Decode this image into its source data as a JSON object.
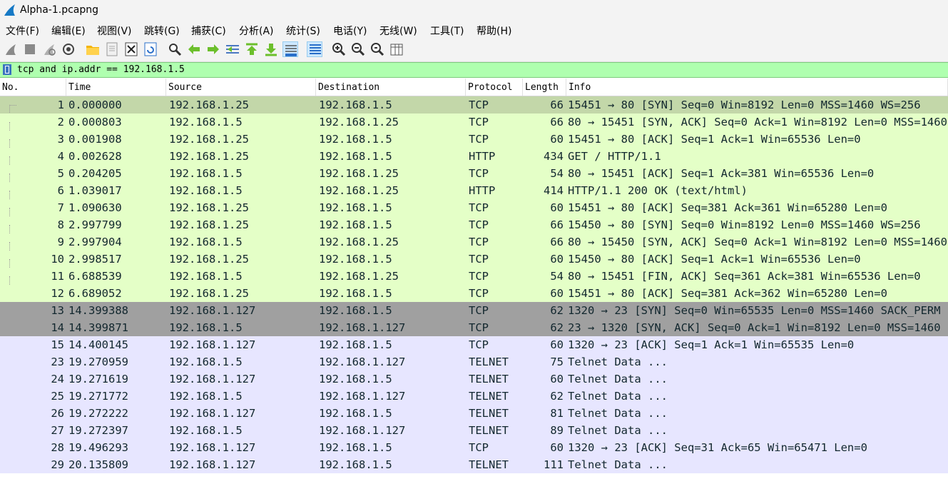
{
  "window": {
    "title": "Alpha-1.pcapng"
  },
  "menu": [
    "文件(F)",
    "编辑(E)",
    "视图(V)",
    "跳转(G)",
    "捕获(C)",
    "分析(A)",
    "统计(S)",
    "电话(Y)",
    "无线(W)",
    "工具(T)",
    "帮助(H)"
  ],
  "toolbar": [
    {
      "name": "start-capture-icon"
    },
    {
      "name": "stop-capture-icon"
    },
    {
      "name": "restart-capture-icon"
    },
    {
      "name": "capture-options-icon"
    },
    {
      "name": "open-file-icon"
    },
    {
      "name": "save-file-icon"
    },
    {
      "name": "close-file-icon"
    },
    {
      "name": "reload-file-icon"
    },
    {
      "name": "find-packet-icon"
    },
    {
      "name": "go-back-icon"
    },
    {
      "name": "go-forward-icon"
    },
    {
      "name": "go-to-packet-icon"
    },
    {
      "name": "go-first-icon"
    },
    {
      "name": "go-last-icon"
    },
    {
      "name": "auto-scroll-icon"
    },
    {
      "name": "colorize-icon"
    },
    {
      "name": "zoom-in-icon"
    },
    {
      "name": "zoom-out-icon"
    },
    {
      "name": "zoom-normal-icon"
    },
    {
      "name": "resize-columns-icon"
    }
  ],
  "filter": {
    "value": "tcp and ip.addr == 192.168.1.5"
  },
  "columns": [
    "No.",
    "Time",
    "Source",
    "Destination",
    "Protocol",
    "Length",
    "Info"
  ],
  "row_colors": {
    "tcp": "#e4ffc7",
    "http": "#e4ffc7",
    "telnet": "#e7e6ff",
    "selected": "#c3d7a9",
    "syn_grey": "#a0a0a0"
  },
  "packets": [
    {
      "no": "1",
      "time": "0.000000",
      "src": "192.168.1.25",
      "dst": "192.168.1.5",
      "proto": "TCP",
      "len": "66",
      "info": "15451 → 80 [SYN] Seq=0 Win=8192 Len=0 MSS=1460 WS=256",
      "style": "selected"
    },
    {
      "no": "2",
      "time": "0.000803",
      "src": "192.168.1.5",
      "dst": "192.168.1.25",
      "proto": "TCP",
      "len": "66",
      "info": "80 → 15451 [SYN, ACK] Seq=0 Ack=1 Win=8192 Len=0 MSS=1460",
      "style": "tcp"
    },
    {
      "no": "3",
      "time": "0.001908",
      "src": "192.168.1.25",
      "dst": "192.168.1.5",
      "proto": "TCP",
      "len": "60",
      "info": "15451 → 80 [ACK] Seq=1 Ack=1 Win=65536 Len=0",
      "style": "tcp"
    },
    {
      "no": "4",
      "time": "0.002628",
      "src": "192.168.1.25",
      "dst": "192.168.1.5",
      "proto": "HTTP",
      "len": "434",
      "info": "GET / HTTP/1.1",
      "style": "http"
    },
    {
      "no": "5",
      "time": "0.204205",
      "src": "192.168.1.5",
      "dst": "192.168.1.25",
      "proto": "TCP",
      "len": "54",
      "info": "80 → 15451 [ACK] Seq=1 Ack=381 Win=65536 Len=0",
      "style": "tcp"
    },
    {
      "no": "6",
      "time": "1.039017",
      "src": "192.168.1.5",
      "dst": "192.168.1.25",
      "proto": "HTTP",
      "len": "414",
      "info": "HTTP/1.1 200 OK  (text/html)",
      "style": "http"
    },
    {
      "no": "7",
      "time": "1.090630",
      "src": "192.168.1.25",
      "dst": "192.168.1.5",
      "proto": "TCP",
      "len": "60",
      "info": "15451 → 80 [ACK] Seq=381 Ack=361 Win=65280 Len=0",
      "style": "tcp"
    },
    {
      "no": "8",
      "time": "2.997799",
      "src": "192.168.1.25",
      "dst": "192.168.1.5",
      "proto": "TCP",
      "len": "66",
      "info": "15450 → 80 [SYN] Seq=0 Win=8192 Len=0 MSS=1460 WS=256",
      "style": "tcp"
    },
    {
      "no": "9",
      "time": "2.997904",
      "src": "192.168.1.5",
      "dst": "192.168.1.25",
      "proto": "TCP",
      "len": "66",
      "info": "80 → 15450 [SYN, ACK] Seq=0 Ack=1 Win=8192 Len=0 MSS=1460",
      "style": "tcp"
    },
    {
      "no": "10",
      "time": "2.998517",
      "src": "192.168.1.25",
      "dst": "192.168.1.5",
      "proto": "TCP",
      "len": "60",
      "info": "15450 → 80 [ACK] Seq=1 Ack=1 Win=65536 Len=0",
      "style": "tcp"
    },
    {
      "no": "11",
      "time": "6.688539",
      "src": "192.168.1.5",
      "dst": "192.168.1.25",
      "proto": "TCP",
      "len": "54",
      "info": "80 → 15451 [FIN, ACK] Seq=361 Ack=381 Win=65536 Len=0",
      "style": "tcp"
    },
    {
      "no": "12",
      "time": "6.689052",
      "src": "192.168.1.25",
      "dst": "192.168.1.5",
      "proto": "TCP",
      "len": "60",
      "info": "15451 → 80 [ACK] Seq=381 Ack=362 Win=65280 Len=0",
      "style": "tcp"
    },
    {
      "no": "13",
      "time": "14.399388",
      "src": "192.168.1.127",
      "dst": "192.168.1.5",
      "proto": "TCP",
      "len": "62",
      "info": "1320 → 23 [SYN] Seq=0 Win=65535 Len=0 MSS=1460 SACK_PERM",
      "style": "syn_grey"
    },
    {
      "no": "14",
      "time": "14.399871",
      "src": "192.168.1.5",
      "dst": "192.168.1.127",
      "proto": "TCP",
      "len": "62",
      "info": "23 → 1320 [SYN, ACK] Seq=0 Ack=1 Win=8192 Len=0 MSS=1460",
      "style": "syn_grey"
    },
    {
      "no": "15",
      "time": "14.400145",
      "src": "192.168.1.127",
      "dst": "192.168.1.5",
      "proto": "TCP",
      "len": "60",
      "info": "1320 → 23 [ACK] Seq=1 Ack=1 Win=65535 Len=0",
      "style": "telnet"
    },
    {
      "no": "23",
      "time": "19.270959",
      "src": "192.168.1.5",
      "dst": "192.168.1.127",
      "proto": "TELNET",
      "len": "75",
      "info": "Telnet Data ...",
      "style": "telnet"
    },
    {
      "no": "24",
      "time": "19.271619",
      "src": "192.168.1.127",
      "dst": "192.168.1.5",
      "proto": "TELNET",
      "len": "60",
      "info": "Telnet Data ...",
      "style": "telnet"
    },
    {
      "no": "25",
      "time": "19.271772",
      "src": "192.168.1.5",
      "dst": "192.168.1.127",
      "proto": "TELNET",
      "len": "62",
      "info": "Telnet Data ...",
      "style": "telnet"
    },
    {
      "no": "26",
      "time": "19.272222",
      "src": "192.168.1.127",
      "dst": "192.168.1.5",
      "proto": "TELNET",
      "len": "81",
      "info": "Telnet Data ...",
      "style": "telnet"
    },
    {
      "no": "27",
      "time": "19.272397",
      "src": "192.168.1.5",
      "dst": "192.168.1.127",
      "proto": "TELNET",
      "len": "89",
      "info": "Telnet Data ...",
      "style": "telnet"
    },
    {
      "no": "28",
      "time": "19.496293",
      "src": "192.168.1.127",
      "dst": "192.168.1.5",
      "proto": "TCP",
      "len": "60",
      "info": "1320 → 23 [ACK] Seq=31 Ack=65 Win=65471 Len=0",
      "style": "telnet"
    },
    {
      "no": "29",
      "time": "20.135809",
      "src": "192.168.1.127",
      "dst": "192.168.1.5",
      "proto": "TELNET",
      "len": "111",
      "info": "Telnet Data ...",
      "style": "telnet"
    }
  ]
}
